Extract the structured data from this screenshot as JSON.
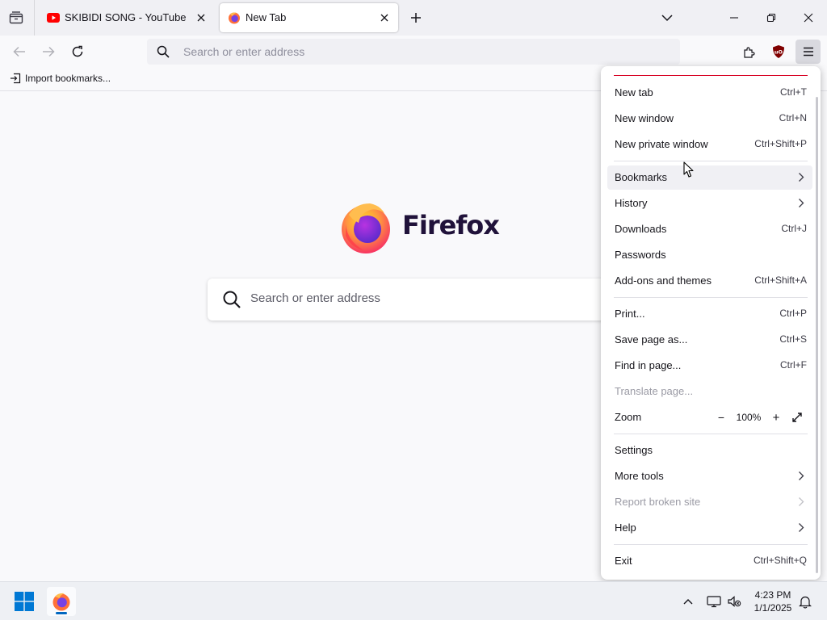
{
  "tabs": [
    {
      "title": "SKIBIDI SONG - YouTube",
      "icon": "youtube-icon",
      "active": false
    },
    {
      "title": "New Tab",
      "icon": "firefox-icon",
      "active": true
    }
  ],
  "navbar": {
    "url_placeholder": "Search or enter address"
  },
  "bookmarks_bar": {
    "import_label": "Import bookmarks..."
  },
  "new_tab_page": {
    "brand": "Firefox",
    "search_placeholder": "Search or enter address"
  },
  "app_menu": {
    "items": [
      {
        "label": "New tab",
        "shortcut": "Ctrl+T"
      },
      {
        "label": "New window",
        "shortcut": "Ctrl+N"
      },
      {
        "label": "New private window",
        "shortcut": "Ctrl+Shift+P"
      },
      {
        "label": "Bookmarks",
        "submenu": true
      },
      {
        "label": "History",
        "submenu": true
      },
      {
        "label": "Downloads",
        "shortcut": "Ctrl+J"
      },
      {
        "label": "Passwords"
      },
      {
        "label": "Add-ons and themes",
        "shortcut": "Ctrl+Shift+A"
      },
      {
        "label": "Print...",
        "shortcut": "Ctrl+P"
      },
      {
        "label": "Save page as...",
        "shortcut": "Ctrl+S"
      },
      {
        "label": "Find in page...",
        "shortcut": "Ctrl+F"
      },
      {
        "label": "Translate page...",
        "disabled": true
      },
      {
        "label": "Zoom"
      },
      {
        "label": "Settings"
      },
      {
        "label": "More tools",
        "submenu": true
      },
      {
        "label": "Report broken site",
        "submenu": true,
        "disabled": true
      },
      {
        "label": "Help",
        "submenu": true
      },
      {
        "label": "Exit",
        "shortcut": "Ctrl+Shift+Q"
      }
    ],
    "zoom": {
      "value": "100%",
      "minus": "−",
      "plus": "+"
    }
  },
  "taskbar": {
    "time": "4:23 PM",
    "date": "1/1/2025"
  },
  "colors": {
    "accent_firefox_orange": "#ff7139",
    "firefox_purple": "#7542e5",
    "youtube_red": "#ff0000",
    "ublock_red": "#800000",
    "windows_blue": "#0078d4"
  }
}
